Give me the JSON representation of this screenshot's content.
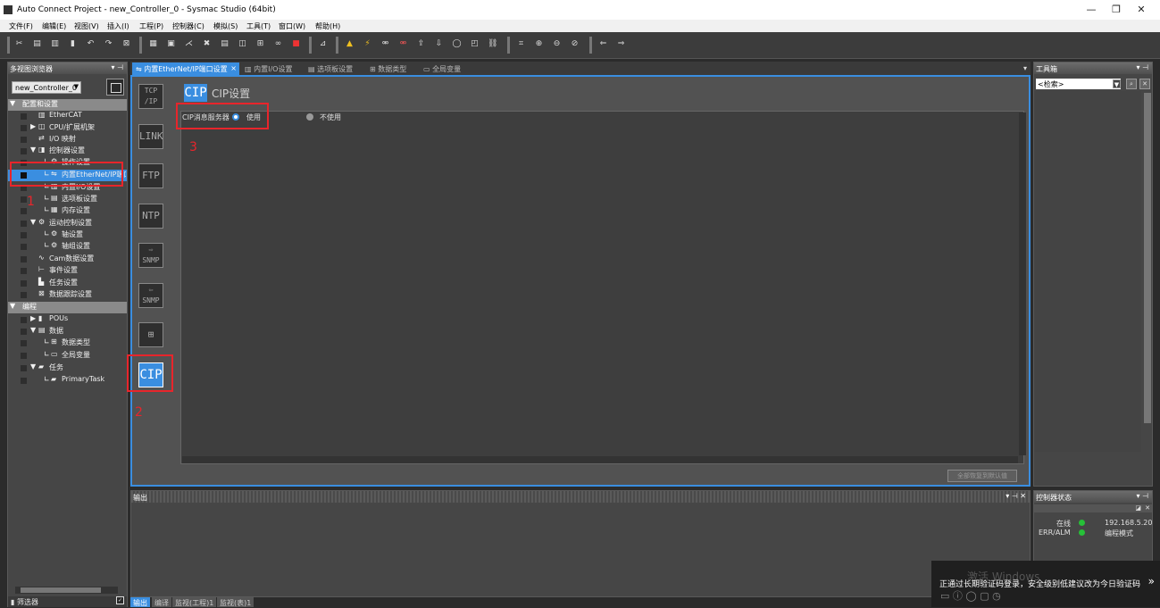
{
  "window": {
    "title": "Auto Connect Project - new_Controller_0 - Sysmac Studio (64bit)",
    "minimize": "—",
    "restore": "❐",
    "close": "✕"
  },
  "menu": [
    "文件(F)",
    "编辑(E)",
    "视图(V)",
    "插入(I)",
    "工程(P)",
    "控制器(C)",
    "模拟(S)",
    "工具(T)",
    "窗口(W)",
    "帮助(H)"
  ],
  "toolbar_icons": [
    "cut-icon",
    "copy-icon",
    "paste-icon",
    "delete-icon",
    "undo-icon",
    "redo-icon",
    "close-icon",
    "cross-reference-icon",
    "window-icon",
    "build-icon",
    "tools-icon",
    "network-icon",
    "compare-icon",
    "hierarchy-icon",
    "binoculars-icon",
    "stop-icon",
    "filter-icon",
    "warning-icon",
    "online-icon",
    "offline-icon",
    "transfer-icon",
    "upload-icon",
    "download-icon",
    "reset-icon",
    "sync-icon",
    "link-icon",
    "zoom-fit-icon",
    "zoom-in-icon",
    "zoom-out-icon",
    "zoom-reset-icon",
    "previous-icon",
    "next-icon"
  ],
  "multiview": {
    "title": "多视图浏览器",
    "controller": "new_Controller_0",
    "sections": {
      "config": "配置和设置",
      "programming": "编程"
    },
    "tree": {
      "ethercat": "EtherCAT",
      "cpu": "CPU/扩展机架",
      "io": "I/O 映射",
      "ctrl": "控制器设置",
      "op": "操作设置",
      "eip": "内置EtherNet/IP端口设置",
      "bio": "内置I/O设置",
      "opt": "选项板设置",
      "mem": "内存设置",
      "motion": "运动控制设置",
      "axis": "轴设置",
      "axisgrp": "轴组设置",
      "cam": "Cam数据设置",
      "event": "事件设置",
      "task": "任务设置",
      "trace": "数据跟踪设置",
      "pous": "POUs",
      "data": "数据",
      "dtype": "数据类型",
      "gvar": "全局变量",
      "tasks": "任务",
      "primary": "PrimaryTask"
    },
    "filter": "筛选器"
  },
  "tabs": [
    {
      "label": "内置EtherNet/IP端口设置",
      "close": "×"
    },
    {
      "label": "内置I/O设置"
    },
    {
      "label": "选项板设置"
    },
    {
      "label": "数据类型"
    },
    {
      "label": "全局变量"
    }
  ],
  "editor": {
    "buttons": {
      "tcp": "TCP/IP",
      "tcp1": "TCP",
      "tcp2": "/IP",
      "link": "LINK",
      "ftp": "FTP",
      "ntp": "NTP",
      "snmp": "SNMP",
      "cip": "CIP"
    },
    "header_icon": "CIP",
    "header_title": "CIP设置",
    "cip_server_label": "CIP消息服务器",
    "use_label": "使用",
    "notuse_label": "不使用",
    "restore_button": "全部恢复到默认值"
  },
  "annotations": [
    "1",
    "2",
    "3"
  ],
  "output": {
    "title": "输出",
    "tabs": [
      "输出",
      "编译",
      "监视(工程)1",
      "监视(表)1"
    ]
  },
  "toolbox": {
    "title": "工具箱",
    "search": "<检索>"
  },
  "status": {
    "title": "控制器状态",
    "online_label": "在线",
    "online_value": "192.168.5.20",
    "err_label": "ERR/ALM",
    "err_value": "编程模式"
  },
  "toast": {
    "message": "正通过长期验证码登录，安全级别低建议改为今日验证码",
    "ghost": "激活 Windows"
  },
  "colors": {
    "accent": "#3a8ee0",
    "annotation": "#e8252b",
    "status_ok": "#26c038"
  }
}
